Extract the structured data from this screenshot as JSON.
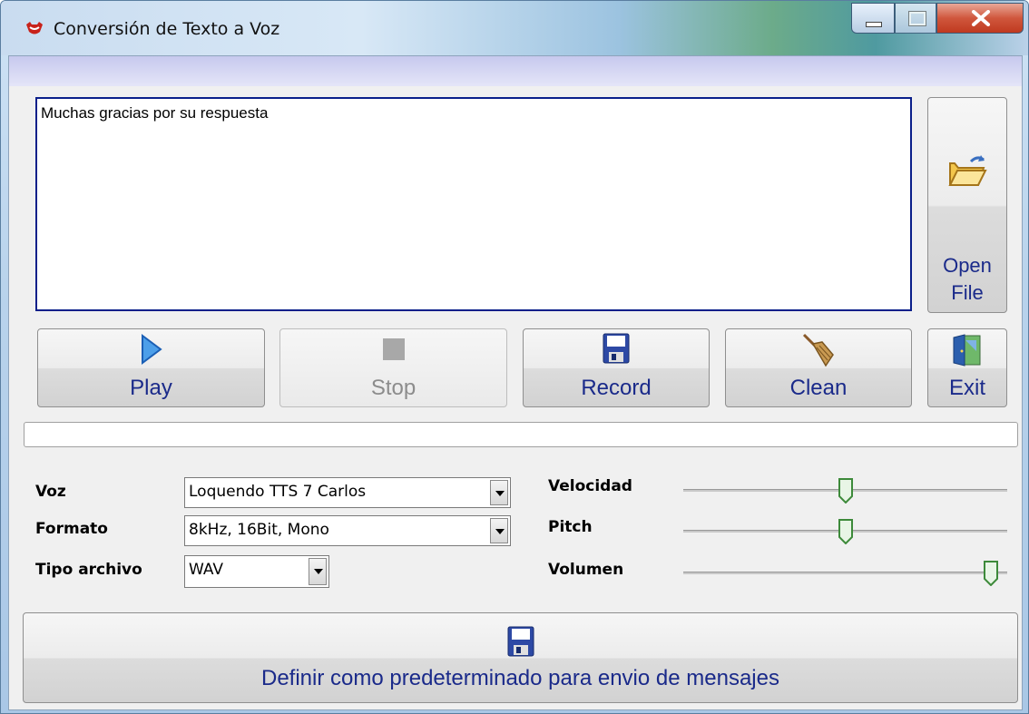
{
  "window": {
    "title": "Conversión de Texto a Voz"
  },
  "text_input": {
    "value": "Muchas gracias por su respuesta"
  },
  "buttons": {
    "open_file": "Open\nFile",
    "play": "Play",
    "stop": "Stop",
    "record": "Record",
    "clean": "Clean",
    "exit": "Exit",
    "define_default": "Definir como predeterminado para envio de mensajes"
  },
  "settings": {
    "voz_label": "Voz",
    "voz_value": "Loquendo TTS 7 Carlos",
    "formato_label": "Formato",
    "formato_value": "8kHz, 16Bit, Mono",
    "tipo_label": "Tipo archivo",
    "tipo_value": "WAV",
    "velocidad_label": "Velocidad",
    "pitch_label": "Pitch",
    "volumen_label": "Volumen"
  },
  "sliders": {
    "velocidad": 0.5,
    "pitch": 0.5,
    "volumen": 0.95
  },
  "colors": {
    "accent_text": "#1a2a8a",
    "textarea_border": "#0a1f8a"
  }
}
